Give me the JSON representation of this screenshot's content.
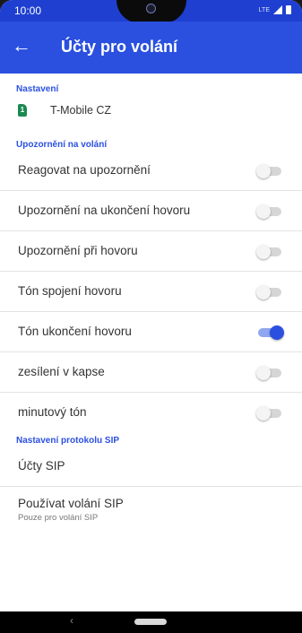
{
  "status_bar": {
    "time": "10:00",
    "network": "LTE"
  },
  "app_bar": {
    "back_icon": "arrow-back-icon",
    "title": "Účty pro volání"
  },
  "colors": {
    "accent": "#2b50e0",
    "status_bar": "#1e3fd0",
    "sim": "#1a8a52"
  },
  "section_settings": {
    "header": "Nastavení",
    "sim_number": "1",
    "carrier": "T-Mobile CZ"
  },
  "section_notifications": {
    "header": "Upozornění na volání",
    "items": [
      {
        "label": "Reagovat na upozornění",
        "on": false
      },
      {
        "label": "Upozornění na ukončení hovoru",
        "on": false
      },
      {
        "label": "Upozornění při hovoru",
        "on": false
      },
      {
        "label": "Tón spojení hovoru",
        "on": false
      },
      {
        "label": "Tón ukončení hovoru",
        "on": true
      },
      {
        "label": "zesílení v kapse",
        "on": false
      },
      {
        "label": "minutový tón",
        "on": false
      }
    ]
  },
  "section_sip": {
    "header": "Nastavení protokolu SIP",
    "accounts_label": "Účty SIP",
    "use_label": "Používat volání SIP",
    "use_sub": "Pouze pro volání SIP"
  },
  "nav_bar": {
    "back_icon": "nav-back-icon",
    "home_icon": "home-pill-icon",
    "back_glyph": "‹"
  }
}
